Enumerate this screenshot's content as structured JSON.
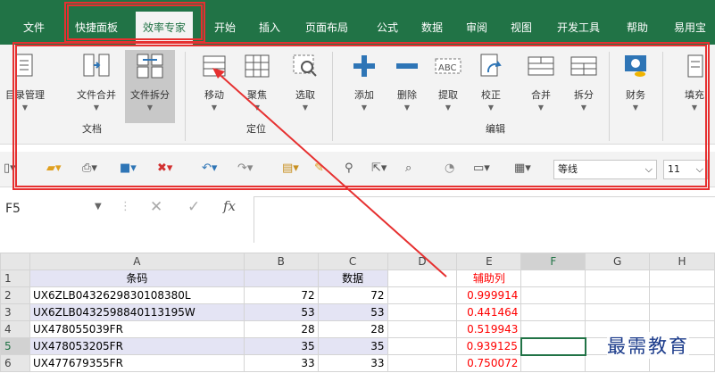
{
  "menu": {
    "tabs": [
      {
        "label": "文件"
      },
      {
        "label": "快捷面板"
      },
      {
        "label": "效率专家"
      },
      {
        "label": "开始"
      },
      {
        "label": "插入"
      },
      {
        "label": "页面布局"
      },
      {
        "label": "公式"
      },
      {
        "label": "数据"
      },
      {
        "label": "审阅"
      },
      {
        "label": "视图"
      },
      {
        "label": "开发工具"
      },
      {
        "label": "帮助"
      },
      {
        "label": "易用宝"
      }
    ],
    "active_tab": "效率专家"
  },
  "ribbon": {
    "groups": [
      {
        "label": "文档",
        "buttons": [
          {
            "label": "目录管理",
            "icon": "directory-icon"
          },
          {
            "label": "文件合并",
            "icon": "file-merge-icon"
          },
          {
            "label": "文件拆分",
            "icon": "file-split-icon",
            "selected": true
          }
        ]
      },
      {
        "label": "定位",
        "buttons": [
          {
            "label": "移动",
            "icon": "move-icon"
          },
          {
            "label": "聚焦",
            "icon": "focus-grid-icon"
          },
          {
            "label": "选取",
            "icon": "select-search-icon"
          }
        ]
      },
      {
        "label": "编辑",
        "buttons": [
          {
            "label": "添加",
            "icon": "plus-icon"
          },
          {
            "label": "删除",
            "icon": "minus-icon"
          },
          {
            "label": "提取",
            "icon": "extract-abc-icon"
          },
          {
            "label": "校正",
            "icon": "correct-icon"
          },
          {
            "label": "合并",
            "icon": "merge-cells-icon"
          },
          {
            "label": "拆分",
            "icon": "split-cells-icon"
          }
        ]
      },
      {
        "label": "",
        "buttons": [
          {
            "label": "财务",
            "icon": "finance-icon"
          },
          {
            "label": "填充",
            "icon": "fill-icon"
          }
        ]
      }
    ]
  },
  "quick_access": {
    "font_name": "等线",
    "font_size": "11"
  },
  "formula_bar": {
    "name_box": "F5",
    "fx": "fx",
    "value": ""
  },
  "sheet": {
    "columns": [
      "A",
      "B",
      "C",
      "D",
      "E",
      "F",
      "G",
      "H"
    ],
    "rows": [
      {
        "n": "1",
        "A": "条码",
        "B": "",
        "C": "数据",
        "D": "",
        "E": "辅助列"
      },
      {
        "n": "2",
        "A": "UX6ZLB0432629830108380L",
        "B": "72",
        "C": "72",
        "D": "",
        "E": "0.999914"
      },
      {
        "n": "3",
        "A": "UX6ZLB0432598840113195W",
        "B": "53",
        "C": "53",
        "D": "",
        "E": "0.441464"
      },
      {
        "n": "4",
        "A": "UX478055039FR",
        "B": "28",
        "C": "28",
        "D": "",
        "E": "0.519943"
      },
      {
        "n": "5",
        "A": "UX478053205FR",
        "B": "35",
        "C": "35",
        "D": "",
        "E": "0.939125"
      },
      {
        "n": "6",
        "A": "UX477679355FR",
        "B": "33",
        "C": "33",
        "D": "",
        "E": "0.750072"
      }
    ],
    "active_cell": "F5"
  },
  "watermark": "最需教育",
  "colors": {
    "accent_green": "#217346",
    "annotation_red": "#e63030",
    "text_red": "#ff0000"
  }
}
